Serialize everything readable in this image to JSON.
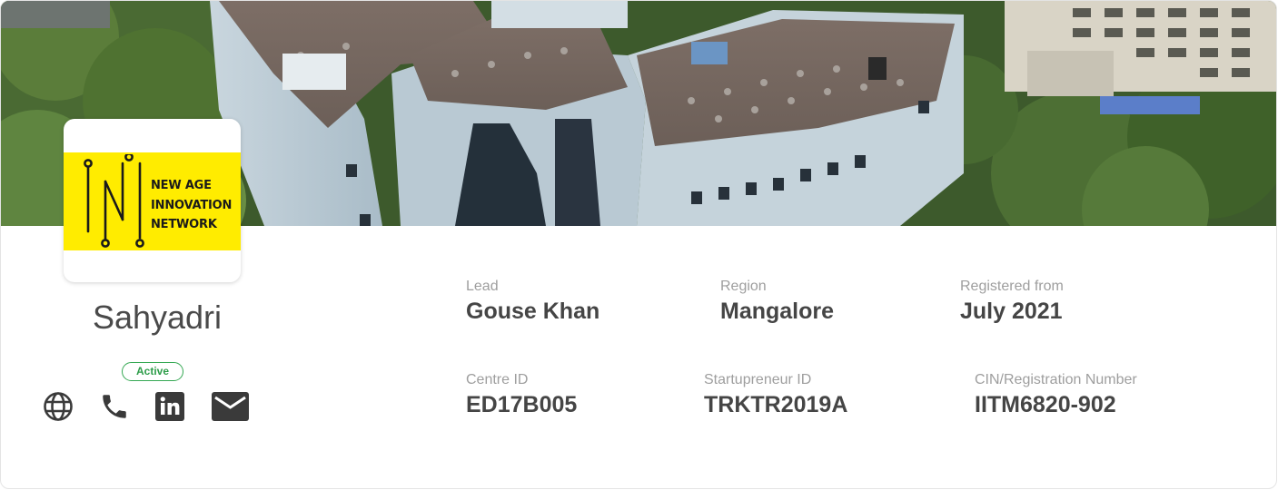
{
  "organization": {
    "name": "Sahyadri",
    "status": "Active",
    "logo_lines": [
      "NEW AGE",
      "INNOVATION",
      "NETWORK"
    ]
  },
  "contact_icons": [
    "globe-icon",
    "phone-icon",
    "linkedin-icon",
    "email-icon"
  ],
  "details": {
    "lead": {
      "label": "Lead",
      "value": "Gouse Khan"
    },
    "region": {
      "label": "Region",
      "value": "Mangalore"
    },
    "registered": {
      "label": "Registered from",
      "value": "July 2021"
    },
    "centre_id": {
      "label": "Centre ID",
      "value": "ED17B005"
    },
    "startupreneur_id": {
      "label": "Startupreneur ID",
      "value": "TRKTR2019A"
    },
    "cin": {
      "label": "CIN/Registration Number",
      "value": "IITM6820-902"
    }
  },
  "colors": {
    "status_green": "#35a853",
    "logo_yellow": "#ffec00",
    "label_gray": "#9e9e9e",
    "value_dark": "#454545",
    "icon_dark": "#3a3a3a"
  }
}
